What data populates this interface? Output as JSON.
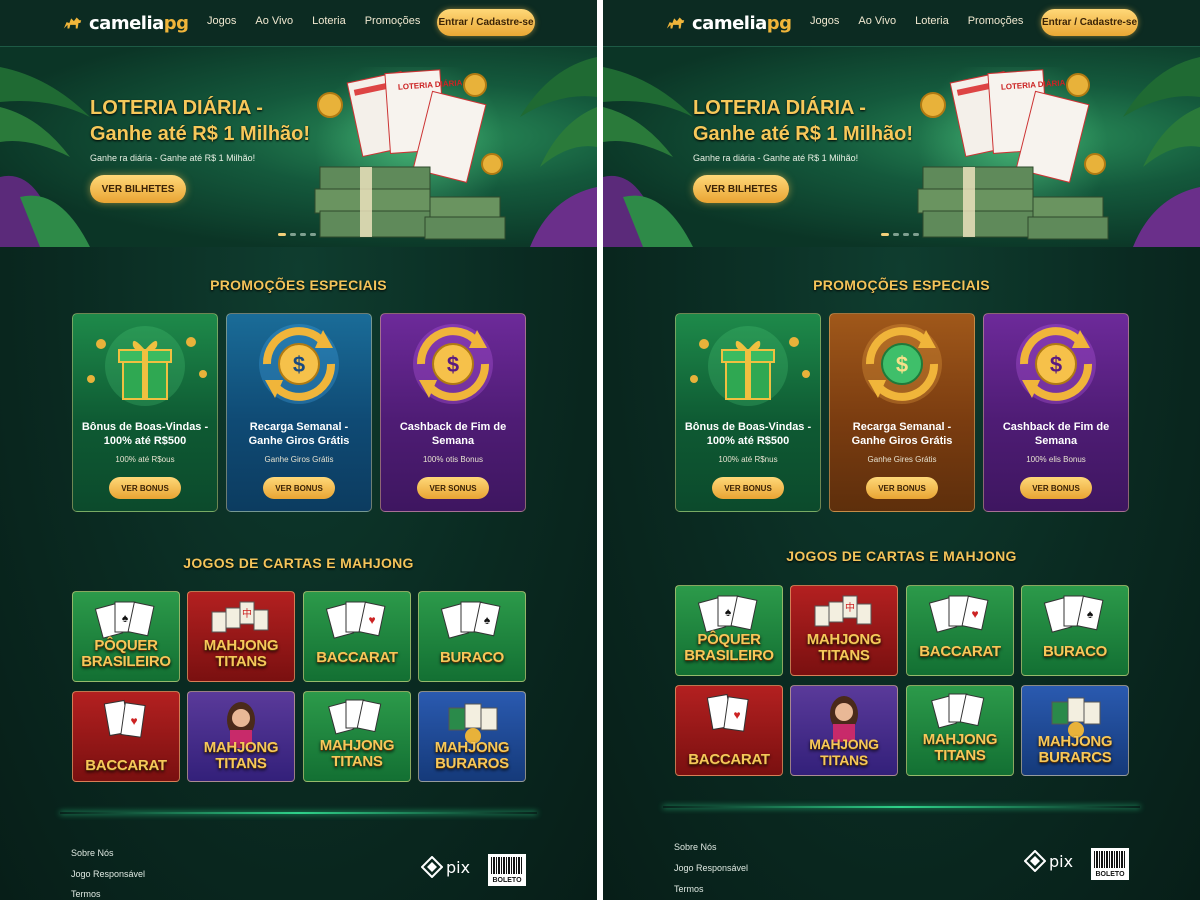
{
  "panels": [
    {
      "header": {
        "logo": {
          "name": "cameliapg",
          "part1": "camelia",
          "part2": "pg"
        },
        "nav": [
          "Jogos",
          "Ao Vivo",
          "Loteria",
          "Promoções"
        ],
        "login_label": "Entrar / Cadastre-se"
      },
      "hero": {
        "title_line1": "LOTERIA DIÁRIA -",
        "title_line2": "Ganhe até R$ 1 Milhão!",
        "subtitle": "Ganhe ra diária - Ganhe até R$ 1 Milhão!",
        "button": "VER BILHETES",
        "ticket_label": "LOTERIA DIÁRIA"
      },
      "promos": {
        "title": "PROMOÇÕES ESPECIAIS",
        "cards": [
          {
            "title1": "Bônus de Boas-Vindas -",
            "title2": "100% até R$500",
            "subtitle": "100% até R$ous",
            "button": "VER BONUS",
            "color": "#0e5a33"
          },
          {
            "title1": "Recarga Semanal -",
            "title2": "Ganhe Giros Grátis",
            "subtitle": "Ganhe Giros Grátis",
            "button": "VER BONUS",
            "color": "#0f4a74"
          },
          {
            "title1": "Cashback de Fim de",
            "title2": "Semana",
            "subtitle": "100% otis Bonus",
            "button": "VER SONUS",
            "color": "#4e1c74"
          }
        ]
      },
      "games": {
        "title": "JOGOS DE CARTAS E MAHJONG",
        "items": [
          {
            "line1": "PÔQUER",
            "line2": "BRASILEIRO"
          },
          {
            "line1": "MAHJONG",
            "line2": "TITANS"
          },
          {
            "line1": "BACCARAT",
            "line2": ""
          },
          {
            "line1": "BURACO",
            "line2": ""
          },
          {
            "line1": "BACCARAT",
            "line2": ""
          },
          {
            "line1": "MAHJONG",
            "line2": "TITANS"
          },
          {
            "line1": "MAHJONG",
            "line2": "TITANS"
          },
          {
            "line1": "MAHJONG",
            "line2": "BURAROS"
          }
        ]
      },
      "footer": {
        "links": [
          "Sobre Nós",
          "Jogo Responsável",
          "Termos"
        ],
        "pix": "pix",
        "boleto": "BOLETO"
      }
    },
    {
      "header": {
        "logo": {
          "name": "cameliapg",
          "part1": "camelia",
          "part2": "pg"
        },
        "nav": [
          "Jogos",
          "Ao Vivo",
          "Loteria",
          "Promoções"
        ],
        "login_label": "Entrar / Cadastre-se"
      },
      "hero": {
        "title_line1": "LOTERIA DIÁRIA -",
        "title_line2": "Ganhe até R$ 1 Milhão!",
        "subtitle": "Ganhe ra diária - Ganhe até R$ 1 Milhão!",
        "button": "VER BILHETES",
        "ticket_label": "LOTERIA DIÁRIA"
      },
      "promos": {
        "title": "PROMOÇÕES ESPECIAIS",
        "cards": [
          {
            "title1": "Bônus de Boas-Vindas -",
            "title2": "100% até R$500",
            "subtitle": "100% até R$nus",
            "button": "VER BONUS",
            "color": "#0e5a33"
          },
          {
            "title1": "Recarga Semanal -",
            "title2": "Ganhe Giros Grátis",
            "subtitle": "Ganhe Gires Grátis",
            "button": "VER BONUS",
            "color": "#7a3c10"
          },
          {
            "title1": "Cashback de Fim de",
            "title2": "Semana",
            "subtitle": "100% elis Bonus",
            "button": "VER BONUS",
            "color": "#4e1c74"
          }
        ]
      },
      "games": {
        "title": "JOGOS DE CARTAS E MAHJONG",
        "items": [
          {
            "line1": "PÔQUER",
            "line2": "BRASILEIRO"
          },
          {
            "line1": "MAHJONG",
            "line2": "TITANS"
          },
          {
            "line1": "BACCARAT",
            "line2": ""
          },
          {
            "line1": "BURACO",
            "line2": ""
          },
          {
            "line1": "BACCARAT",
            "line2": ""
          },
          {
            "line1": "MAHJONG",
            "line2": "TITANS"
          },
          {
            "line1": "MAHJONG",
            "line2": "TITANS"
          },
          {
            "line1": "MAHJONG",
            "line2": "BURARCS"
          }
        ]
      },
      "footer": {
        "links": [
          "Sobre Nós",
          "Jogo Responsável",
          "Termos"
        ],
        "pix": "pix",
        "boleto": "BOLETO"
      }
    }
  ]
}
